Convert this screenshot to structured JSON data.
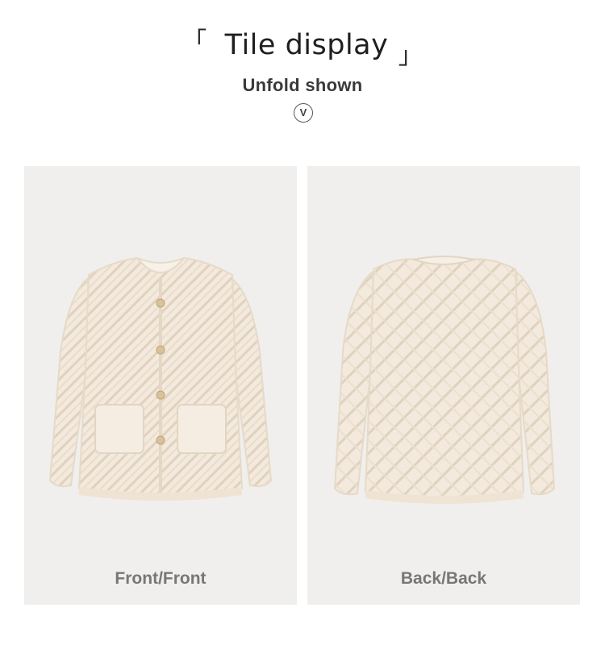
{
  "header": {
    "bracket_open": "「",
    "title": "Tile display",
    "bracket_close": "」",
    "subtitle": "Unfold shown",
    "unfold_icon_glyph": "V"
  },
  "panels": [
    {
      "caption": "Front/Front",
      "icon": "cardigan-front-image"
    },
    {
      "caption": "Back/Back",
      "icon": "cardigan-back-image"
    }
  ],
  "colors": {
    "panel_bg": "#f0efed",
    "garment": "#f3e9dc",
    "garment_shade": "#e2d5c3",
    "button": "#d8c29a",
    "caption": "#777774"
  }
}
